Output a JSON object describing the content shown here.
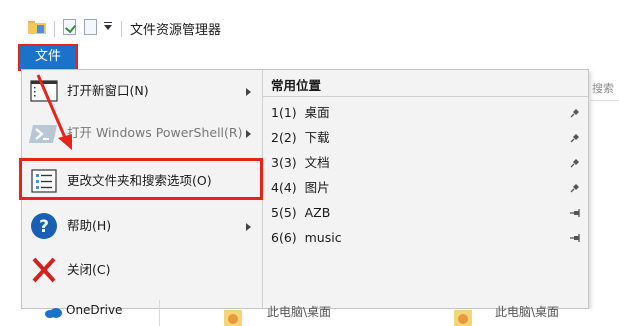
{
  "window": {
    "title": "文件资源管理器"
  },
  "ribbon": {
    "file_tab": "文件"
  },
  "menu": {
    "items": [
      {
        "label": "打开新窗口(N)",
        "has_submenu": true,
        "icon": "new-window-icon"
      },
      {
        "label": "打开 Windows PowerShell(R)",
        "has_submenu": true,
        "icon": "powershell-icon"
      },
      {
        "label": "更改文件夹和搜索选项(O)",
        "has_submenu": false,
        "icon": "folder-options-icon"
      },
      {
        "label": "帮助(H)",
        "has_submenu": true,
        "icon": "help-icon"
      },
      {
        "label": "关闭(C)",
        "has_submenu": false,
        "icon": "close-icon"
      }
    ],
    "recent": {
      "header": "常用位置",
      "items": [
        {
          "num": "1(1)",
          "name": "桌面",
          "pinned": true
        },
        {
          "num": "2(2)",
          "name": "下载",
          "pinned": true
        },
        {
          "num": "3(3)",
          "name": "文档",
          "pinned": true
        },
        {
          "num": "4(4)",
          "name": "图片",
          "pinned": true
        },
        {
          "num": "5(5)",
          "name": "AZB",
          "pinned": false
        },
        {
          "num": "6(6)",
          "name": "music",
          "pinned": false
        }
      ]
    }
  },
  "background": {
    "search_hint": "搜索",
    "nav_item": "OneDrive",
    "paths": [
      "此电脑\\桌面",
      "此电脑\\桌面"
    ]
  },
  "colors": {
    "accent": "#1a73c9",
    "highlight": "#e8231a"
  }
}
